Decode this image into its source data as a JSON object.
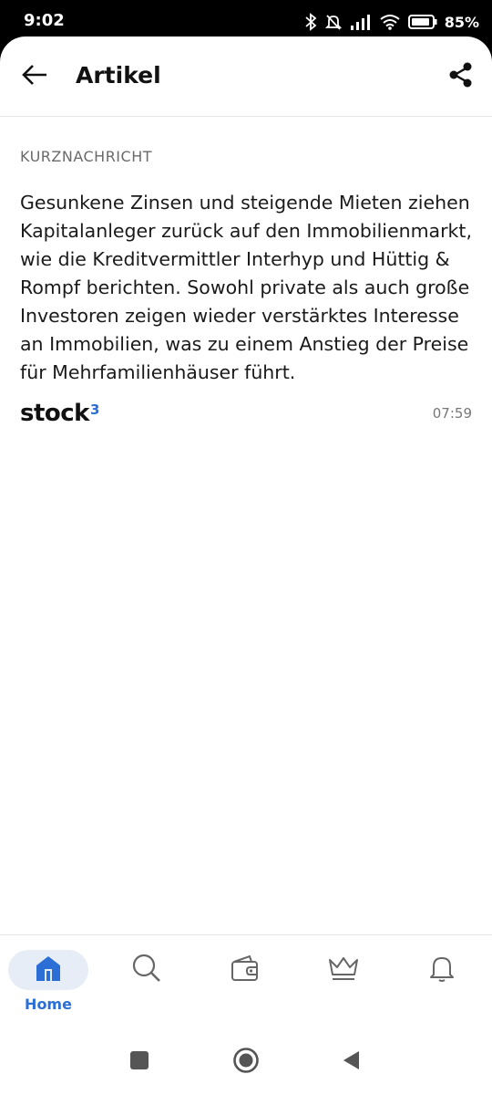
{
  "status_bar": {
    "time": "9:02",
    "battery": "85%",
    "icons": [
      "bluetooth-icon",
      "mute-bell-icon",
      "signal-icon",
      "wifi-icon",
      "battery-icon"
    ]
  },
  "header": {
    "title": "Artikel",
    "back_icon": "arrow-left-icon",
    "share_icon": "share-icon"
  },
  "article": {
    "category": "KURZNACHRICHT",
    "body": "Gesunkene Zinsen und steigende Mieten ziehen Kapitalanleger zurück auf den Immobilienmarkt, wie die Kreditvermittler Interhyp und Hüttig & Rompf berichten. Sowohl private als auch große Investoren zeigen wieder verstärktes Interesse an Immobilien, was zu einem Anstieg der Preise für Mehrfamilienhäuser führt.",
    "source": "stock",
    "source_superscript": "3",
    "time": "07:59"
  },
  "bottom_nav": {
    "items": [
      {
        "label": "Home",
        "icon": "home-icon",
        "active": true
      },
      {
        "label": "",
        "icon": "search-icon",
        "active": false
      },
      {
        "label": "",
        "icon": "wallet-icon",
        "active": false
      },
      {
        "label": "",
        "icon": "crown-icon",
        "active": false
      },
      {
        "label": "",
        "icon": "bell-icon",
        "active": false
      }
    ]
  },
  "colors": {
    "accent": "#2b6fd6",
    "active_pill": "#e7edf7",
    "text": "#1a1a1a",
    "muted": "#6a6a6a"
  }
}
